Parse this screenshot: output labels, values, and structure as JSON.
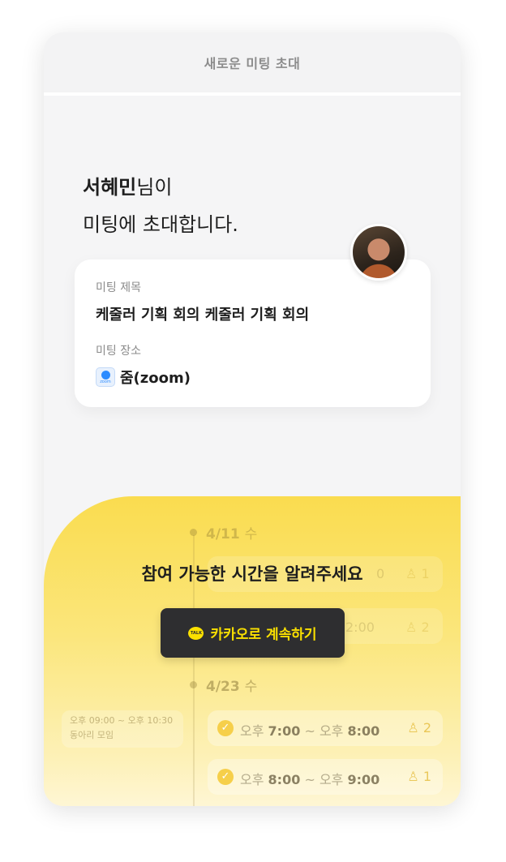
{
  "header": {
    "title": "새로운 미팅 초대"
  },
  "invite": {
    "host_name": "서혜민",
    "host_suffix": "님이",
    "line2": "미팅에 초대합니다."
  },
  "meeting": {
    "title_label": "미팅 제목",
    "title_value": "케줄러 기획 회의 케줄러 기획 회의",
    "location_label": "미팅 장소",
    "location_value": "줌(zoom)",
    "location_icon": "zoom-icon",
    "location_icon_text": "zoom"
  },
  "schedule": {
    "dates": [
      {
        "date": "4/11",
        "weekday": "수"
      },
      {
        "date": "4/23",
        "weekday": "수"
      }
    ],
    "faint_slots": [
      {
        "time_fragment": "0",
        "count": "1"
      },
      {
        "time_fragment": "2:00",
        "count": "2"
      }
    ],
    "slots": [
      {
        "start_prefix": "오후",
        "start": "7:00",
        "sep": "~",
        "end_prefix": "오후",
        "end": "8:00",
        "count": "2"
      },
      {
        "start_prefix": "오후",
        "start": "8:00",
        "sep": "~",
        "end_prefix": "오후",
        "end": "9:00",
        "count": "1"
      }
    ],
    "other_event": {
      "time": "오후 09:00 ~ 오후 10:30",
      "name": "동아리 모임"
    }
  },
  "cta": {
    "title": "참여 가능한 시간을 알려주세요",
    "button_label": "카카오로 계속하기",
    "button_icon_text": "TALK"
  },
  "colors": {
    "accent_yellow": "#fadc4f",
    "kakao_button_bg": "#2e2e30",
    "kakao_text": "#fae000"
  }
}
